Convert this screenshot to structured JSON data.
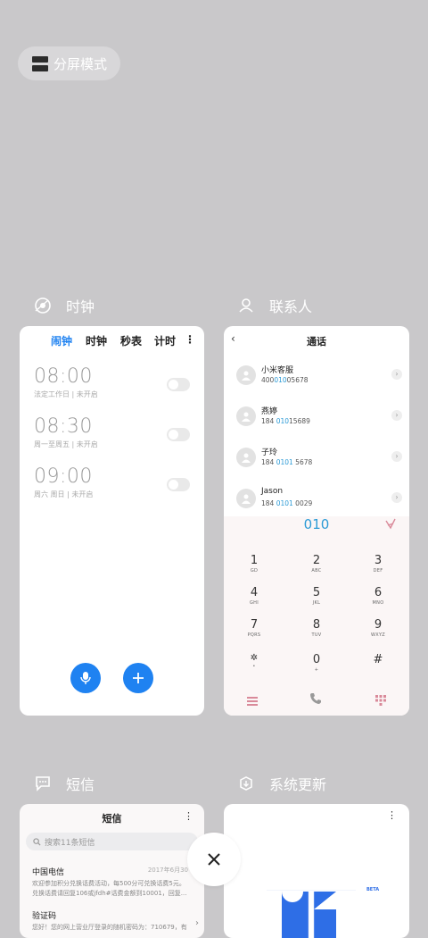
{
  "split_mode": {
    "label": "分屏模式",
    "icon": "split-screen-icon"
  },
  "apps": {
    "clock": {
      "label": "时钟",
      "icon": "clock-app-icon",
      "tabs": [
        "闹钟",
        "时钟",
        "秒表",
        "计时"
      ],
      "active_tab_color": "#1f82f1",
      "alarms": [
        {
          "time": "08:00",
          "sub": "法定工作日 | 未开启"
        },
        {
          "time": "08:30",
          "sub": "周一至周五 | 未开启"
        },
        {
          "time": "09:00",
          "sub": "周六 周日 | 未开启"
        }
      ]
    },
    "contacts": {
      "label": "联系人",
      "icon": "contacts-app-icon",
      "title": "通话",
      "entries": [
        {
          "name": "小米客服",
          "num_pre": "400",
          "num_hl": "010",
          "num_post": "05678"
        },
        {
          "name": "燕婷",
          "num_pre": "184 ",
          "num_hl": "010",
          "num_post": "15689"
        },
        {
          "name": "子玲",
          "num_pre": "184 ",
          "num_hl": "0101",
          "num_post": " 5678"
        },
        {
          "name": "Jason",
          "num_pre": "184 ",
          "num_hl": "0101",
          "num_post": " 0029"
        }
      ],
      "dialed": "010",
      "keys": [
        {
          "d": "1",
          "l": "GD"
        },
        {
          "d": "2",
          "l": "ABC"
        },
        {
          "d": "3",
          "l": "DEF"
        },
        {
          "d": "4",
          "l": "GHI"
        },
        {
          "d": "5",
          "l": "JKL"
        },
        {
          "d": "6",
          "l": "MNO"
        },
        {
          "d": "7",
          "l": "PQRS"
        },
        {
          "d": "8",
          "l": "TUV"
        },
        {
          "d": "9",
          "l": "WXYZ"
        },
        {
          "d": "✲",
          "l": "•"
        },
        {
          "d": "0",
          "l": "+"
        },
        {
          "d": "#",
          "l": ""
        }
      ]
    },
    "sms": {
      "label": "短信",
      "icon": "sms-app-icon",
      "title": "短信",
      "search_placeholder": "搜索11条短信",
      "messages": [
        {
          "sender": "中国电信",
          "date": "2017年6月30",
          "line1": "欢迎参加积分兑换话费活动，每500分可兑换话费5元。",
          "line2": "兑换话费请回复106或jfdh#话费金额到10001，回复..."
        },
        {
          "sender": "验证码",
          "date": "",
          "line1": "您好！您的网上营业厅登录的随机密码为：710679，有",
          "line2": ""
        }
      ]
    },
    "update": {
      "label": "系统更新",
      "icon": "system-update-app-icon",
      "badge": "BETA"
    }
  },
  "close_button": {
    "icon": "close-icon"
  }
}
